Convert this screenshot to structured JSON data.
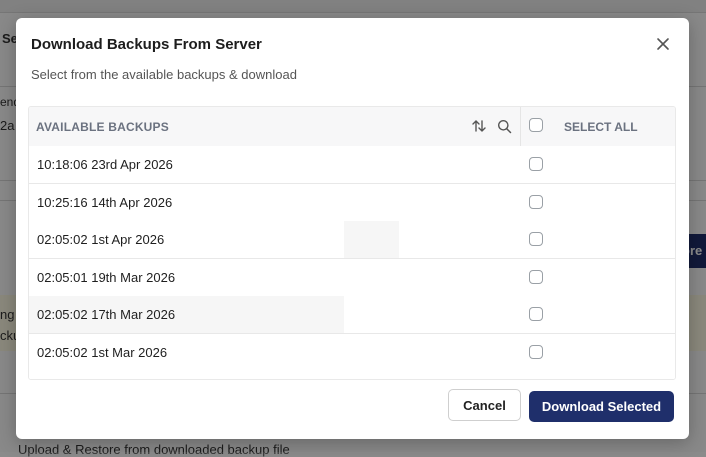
{
  "modal": {
    "title": "Download Backups From Server",
    "subtitle": "Select from the available backups & download",
    "close_icon": "close-icon"
  },
  "table": {
    "header": {
      "column_label": "AVAILABLE BACKUPS",
      "sort_icon": "sort-icon",
      "search_icon": "search-icon",
      "select_all_label": "SELECT ALL"
    },
    "rows": [
      {
        "label": "10:18:06 23rd Apr 2026",
        "checked": false
      },
      {
        "label": "10:25:16 14th Apr 2026",
        "checked": false
      },
      {
        "label": "02:05:02 1st Apr 2026",
        "checked": false
      },
      {
        "label": "02:05:01 19th Mar 2026",
        "checked": false
      },
      {
        "label": "02:05:02 17th Mar 2026",
        "checked": false
      },
      {
        "label": "02:05:02 1st Mar 2026",
        "checked": false
      }
    ]
  },
  "footer": {
    "cancel_label": "Cancel",
    "download_label": "Download Selected"
  },
  "colors": {
    "primary": "#1f2f6b",
    "header_bg": "#f7f7f8",
    "overlay": "rgba(0,0,0,0.45)"
  },
  "background_page": {
    "fragment_1": "Se",
    "fragment_2": "end",
    "fragment_3": "2a",
    "fragment_4": "ng",
    "fragment_5": "cku",
    "fragment_6": "ore",
    "fragment_7": "Upload & Restore from downloaded backup file"
  }
}
